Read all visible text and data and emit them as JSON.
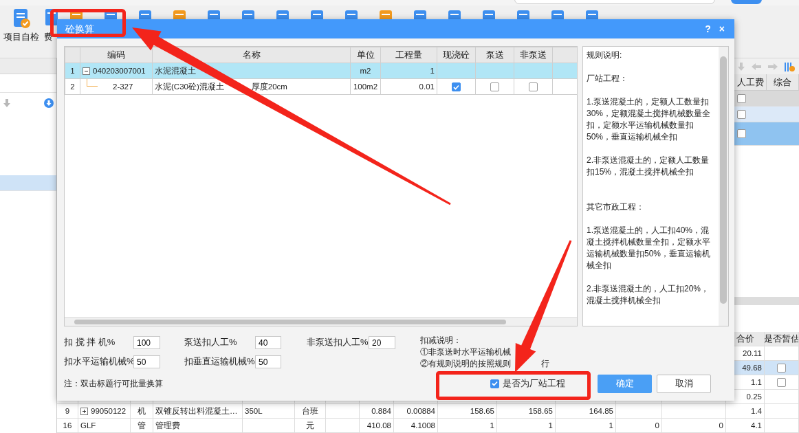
{
  "app": {
    "toolbar": {
      "buttons": [
        {
          "label": "项目自检"
        },
        {
          "label": "费"
        }
      ]
    },
    "left_panel": {
      "rows": [
        {
          "selected": false
        },
        {
          "selected": true
        }
      ]
    },
    "right_table": {
      "columns": [
        "人工费",
        "综合"
      ],
      "rows": [
        {
          "kind": "group",
          "selected": false,
          "checked": false
        },
        {
          "kind": "item",
          "selected": false,
          "checked": false
        },
        {
          "kind": "item",
          "selected": true,
          "checked": false
        }
      ]
    },
    "bottom_table": {
      "columns": [
        "合价",
        "是否暂估"
      ],
      "rows": [
        {
          "selected": false,
          "total": "20.11"
        },
        {
          "selected": true,
          "total": "49.68",
          "estimate": false
        },
        {
          "selected": false,
          "total": "1.1",
          "estimate": false
        },
        {
          "selected": false,
          "total": "0.25"
        },
        {
          "selected": false,
          "expanded": false,
          "cells": [
            "9",
            "99050122",
            "机",
            "双锥反转出料混凝土…",
            "350L",
            "台班",
            null,
            "0.884",
            "0.00884",
            "158.65",
            "158.65",
            "164.85",
            null,
            null
          ],
          "total": "1.4"
        },
        {
          "selected": false,
          "cells": [
            "16",
            "GLF",
            "管",
            "管理费",
            null,
            "元",
            null,
            "410.08",
            "4.1008",
            "1",
            "1",
            "1",
            "0",
            "0"
          ],
          "total": "4.1"
        }
      ]
    }
  },
  "dialog": {
    "title": "砼换算",
    "help_button": "?",
    "close_button": "×",
    "table": {
      "columns": [
        "编码",
        "名称",
        "单位",
        "工程量",
        "现浇砼",
        "泵送",
        "非泵送"
      ],
      "rows": [
        {
          "num": "1",
          "selected": true,
          "expanded": true,
          "code": "040203007001",
          "name": [
            "水泥混凝土"
          ],
          "unit": "m2",
          "quantity": "1"
        },
        {
          "num": "2",
          "selected": false,
          "code": "2-327",
          "name": [
            "水泥(C30砼)混凝土",
            "厚度20cm"
          ],
          "unit": "100m2",
          "quantity": "0.01",
          "cast_in_place": true,
          "pumped": false,
          "non_pumped": false
        }
      ]
    },
    "rules": {
      "title": "规则说明:",
      "sections": [
        {
          "heading": "厂站工程：",
          "items": [
            "1.泵送混凝土的，定额人工数量扣30%，定额混凝土搅拌机械数量全扣，定额水平运输机械数量扣50%，垂直运输机械全扣",
            "2.非泵送混凝土的，定额人工数量扣15%，混凝土搅拌机械全扣"
          ]
        },
        {
          "heading": "其它市政工程：",
          "items": [
            "1.泵送混凝土的，人工扣40%，混凝土搅拌机械数量全扣，定额水平运输机械数量扣50%，垂直运输机械全扣",
            "2.非泵送混凝土的，人工扣20%，混凝土搅拌机械全扣"
          ]
        }
      ]
    },
    "fields": [
      {
        "label": "扣 搅 拌 机%",
        "value": "100"
      },
      {
        "label": "泵送扣人工%",
        "value": "40"
      },
      {
        "label": "非泵送扣人工%",
        "value": "20"
      },
      {
        "label": "扣水平运输机械%",
        "value": "50"
      },
      {
        "label": "扣垂直运输机械%",
        "value": "50"
      }
    ],
    "deduction_note": {
      "title": "扣减说明：",
      "lines": [
        [
          "①非泵送时水平运输机械"
        ],
        [
          "②有规则说明的按照规则",
          "行"
        ]
      ]
    },
    "note": "注：双击标题行可批量换算",
    "plant_checkbox": {
      "label": "是否为厂站工程",
      "checked": true
    },
    "buttons": [
      {
        "label": "确定",
        "kind": "primary"
      },
      {
        "label": "取消",
        "kind": "secondary"
      }
    ]
  }
}
